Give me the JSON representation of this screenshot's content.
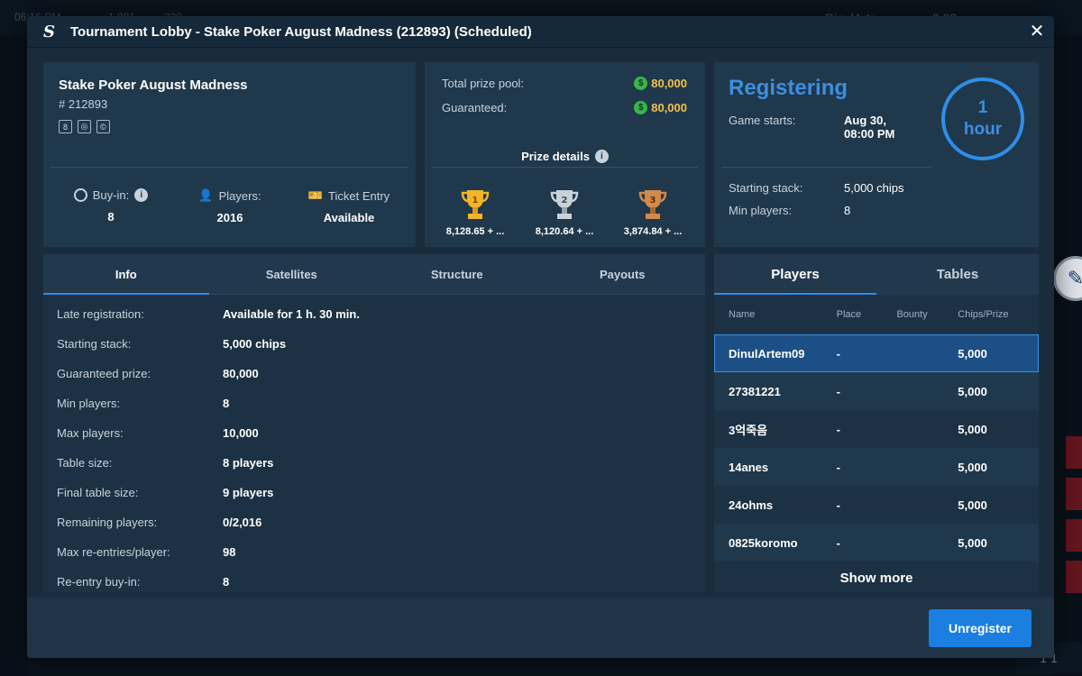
{
  "background": {
    "top_items": [
      "06:16 PM",
      "1,981",
      "320",
      "DinulArte",
      "0.03"
    ],
    "bottom_right_label": "1 1"
  },
  "modal": {
    "title": "Tournament Lobby - Stake Poker August Madness (212893) (Scheduled)",
    "close_icon": "close-icon"
  },
  "tournament": {
    "name": "Stake Poker August Madness",
    "id": "# 212893",
    "badges": [
      "8",
      "◎",
      "©"
    ],
    "buyin_label": "Buy-in:",
    "buyin_value": "8",
    "players_label": "Players:",
    "players_value": "2016",
    "ticket_label": "Ticket Entry",
    "ticket_value": "Available"
  },
  "prize": {
    "total_label": "Total prize pool:",
    "total_value": "80,000",
    "guaranteed_label": "Guaranteed:",
    "guaranteed_value": "80,000",
    "details_label": "Prize details",
    "places": [
      {
        "place": "1",
        "amount": "8,128.65 + ...",
        "color": "#f2b52a"
      },
      {
        "place": "2",
        "amount": "8,120.64 + ...",
        "color": "#c9d1d9"
      },
      {
        "place": "3",
        "amount": "3,874.84 + ...",
        "color": "#d08a4a"
      }
    ]
  },
  "status": {
    "label": "Registering",
    "game_starts_label": "Game starts:",
    "game_starts_date": "Aug 30,",
    "game_starts_time": "08:00 PM",
    "timer_value": "1",
    "timer_unit": "hour",
    "starting_stack_label": "Starting stack:",
    "starting_stack_value": "5,000 chips",
    "min_players_label": "Min players:",
    "min_players_value": "8"
  },
  "tabs": [
    "Info",
    "Satellites",
    "Structure",
    "Payouts"
  ],
  "info": [
    {
      "k": "Late registration:",
      "v": "Available for 1 h. 30 min."
    },
    {
      "k": "Starting stack:",
      "v": "5,000 chips"
    },
    {
      "k": "Guaranteed prize:",
      "v": "80,000"
    },
    {
      "k": "Min players:",
      "v": "8"
    },
    {
      "k": "Max players:",
      "v": "10,000"
    },
    {
      "k": "Table size:",
      "v": "8 players"
    },
    {
      "k": "Final table size:",
      "v": "9 players"
    },
    {
      "k": "Remaining players:",
      "v": "0/2,016"
    },
    {
      "k": "Max re-entries/player:",
      "v": "98"
    },
    {
      "k": "Re-entry buy-in:",
      "v": "8"
    }
  ],
  "players_tabs": [
    "Players",
    "Tables"
  ],
  "players_columns": [
    "Name",
    "Place",
    "Bounty",
    "Chips/Prize"
  ],
  "players": [
    {
      "name": "DinulArtem09",
      "place": "-",
      "bounty": "",
      "chips": "5,000"
    },
    {
      "name": "27381221",
      "place": "-",
      "bounty": "",
      "chips": "5,000"
    },
    {
      "name": "3억죽음",
      "place": "-",
      "bounty": "",
      "chips": "5,000"
    },
    {
      "name": "14anes",
      "place": "-",
      "bounty": "",
      "chips": "5,000"
    },
    {
      "name": "24ohms",
      "place": "-",
      "bounty": "",
      "chips": "5,000"
    },
    {
      "name": "0825koromo",
      "place": "-",
      "bounty": "",
      "chips": "5,000"
    }
  ],
  "show_more_label": "Show more",
  "unregister_label": "Unregister",
  "colors": {
    "accent": "#2f8ee8",
    "gold": "#f2c14e",
    "coin": "#3bb54a"
  }
}
